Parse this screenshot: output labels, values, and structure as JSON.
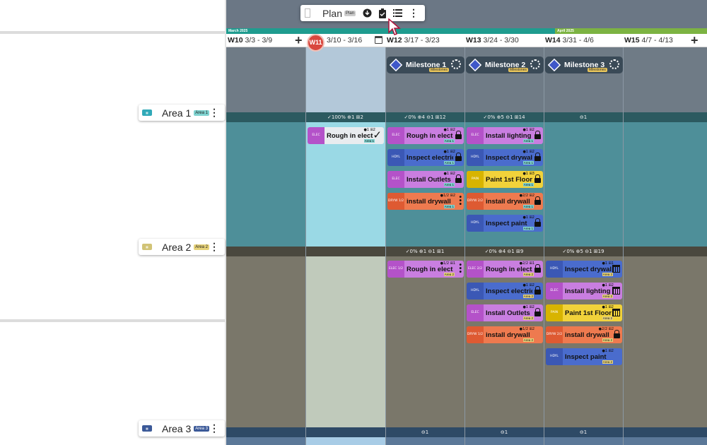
{
  "toolbar": {
    "title": "Plan",
    "tag": "Plan",
    "icons": [
      "download-icon",
      "clipboard-check-icon",
      "list-icon",
      "more-vert-icon"
    ]
  },
  "months": [
    {
      "label": "March 2025",
      "color": "#1f9c8f"
    },
    {
      "label": "April 2025",
      "color": "#7cb342"
    }
  ],
  "weeks": [
    {
      "code": "W10",
      "range": "3/3 - 3/9"
    },
    {
      "code": "W11",
      "range": "3/10 - 3/16",
      "today": true
    },
    {
      "code": "W12",
      "range": "3/17 - 3/23"
    },
    {
      "code": "W13",
      "range": "3/24 - 3/30"
    },
    {
      "code": "W14",
      "range": "3/31 - 4/6"
    },
    {
      "code": "W15",
      "range": "4/7 - 4/13"
    }
  ],
  "today_label": "W11",
  "milestones": [
    {
      "name": "Milestone 1",
      "tag": "Milestones"
    },
    {
      "name": "Milestone 2",
      "tag": "Milestones"
    },
    {
      "name": "Milestone 3",
      "tag": "Milestones"
    }
  ],
  "areas": [
    {
      "name": "Area 1",
      "tag": "Area 1",
      "tag_color": "#7fd3d0",
      "icon_color": "#31a9b8"
    },
    {
      "name": "Area 2",
      "tag": "Area 2",
      "tag_color": "#e6d27a",
      "icon_color": "#d1c376"
    },
    {
      "name": "Area 3",
      "tag": "Area 3",
      "tag_color": "#3b5998",
      "icon_color": "#3b5998"
    }
  ],
  "summaries": {
    "area1": [
      "✓100% ⊕1 ⊞2",
      "✓0% ⊕4 ⊖1 ⊞12",
      "✓0% ⊕5 ⊖1 ⊞14",
      "⊖1"
    ],
    "area2": [
      "✓0% ⊕1 ⊖1 ⊞1",
      "✓0% ⊕4 ⊖1 ⊞9",
      "✓0% ⊕5 ⊖1 ⊞19"
    ],
    "area3": [
      "⊖1",
      "⊖1",
      "⊖1"
    ]
  },
  "tasks": {
    "a1w11": [
      {
        "trade": "ELEC",
        "name": "Rough in electrical",
        "meta": "●1 ⊞2",
        "tag": "Area 1"
      }
    ],
    "a1w12": [
      {
        "trade": "ELEC",
        "name": "Rough in electrical",
        "meta": "●1 ⊞2",
        "tag": "Area 1"
      },
      {
        "trade": "HDYL",
        "name": "Inspect electrical",
        "meta": "●1 ⊞2",
        "tag": "Area 1"
      },
      {
        "trade": "ELEC",
        "name": "Install Outlets",
        "meta": "●1 ⊞2",
        "tag": "Area 1"
      },
      {
        "trade": "DRYW 1/2",
        "name": "install drywall",
        "meta": "●1/2 ⊞2",
        "tag": "Area 1"
      }
    ],
    "a1w13": [
      {
        "trade": "ELEC",
        "name": "Install lighting",
        "meta": "●1 ⊞2",
        "tag": "Area 1"
      },
      {
        "trade": "HDYL",
        "name": "Inspect drywall",
        "meta": "●1 ⊞2",
        "tag": "Area 1"
      },
      {
        "trade": "PAIN",
        "name": "Paint 1st Floor",
        "meta": "●1 ⊞3",
        "tag": "Area 1"
      },
      {
        "trade": "DRYW 2/2",
        "name": "install drywall",
        "meta": "●2/2 ⊞2",
        "tag": "Area 1"
      },
      {
        "trade": "HDYL",
        "name": "Inspect paint",
        "meta": "●1 ⊞2",
        "tag": "Area 1"
      }
    ],
    "a2w12": [
      {
        "trade": "ELEC 1/2",
        "name": "Rough in electrical",
        "meta": "●1/2 ⊞1",
        "tag": "Area 2"
      }
    ],
    "a2w13": [
      {
        "trade": "ELEC 2/2",
        "name": "Rough in electrical",
        "meta": "●2/2 ⊞1",
        "tag": "Area 2"
      },
      {
        "trade": "HDYL",
        "name": "Inspect electrical",
        "meta": "●1 ⊞2",
        "tag": "Area 2"
      },
      {
        "trade": "ELEC",
        "name": "Install Outlets",
        "meta": "●1 ⊞2",
        "tag": "Area 2"
      },
      {
        "trade": "DRYW 1/2",
        "name": "install drywall",
        "meta": "●1/2 ⊞2",
        "tag": "Area 2"
      }
    ],
    "a2w14": [
      {
        "trade": "HDYL",
        "name": "Inspect drywall",
        "meta": "●1 ⊞1",
        "tag": "Area 2"
      },
      {
        "trade": "ELEC",
        "name": "Install lighting",
        "meta": "●1 ⊞2",
        "tag": "Area 2"
      },
      {
        "trade": "PAIN",
        "name": "Paint 1st Floor",
        "meta": "●1 ⊞2",
        "tag": "Area 2"
      },
      {
        "trade": "DRYW 2/2",
        "name": "install drywall",
        "meta": "●2/2 ⊞2",
        "tag": "Area 2"
      },
      {
        "trade": "HDYL",
        "name": "Inspect paint",
        "meta": "●1 ⊞2",
        "tag": "Area 2"
      }
    ]
  }
}
